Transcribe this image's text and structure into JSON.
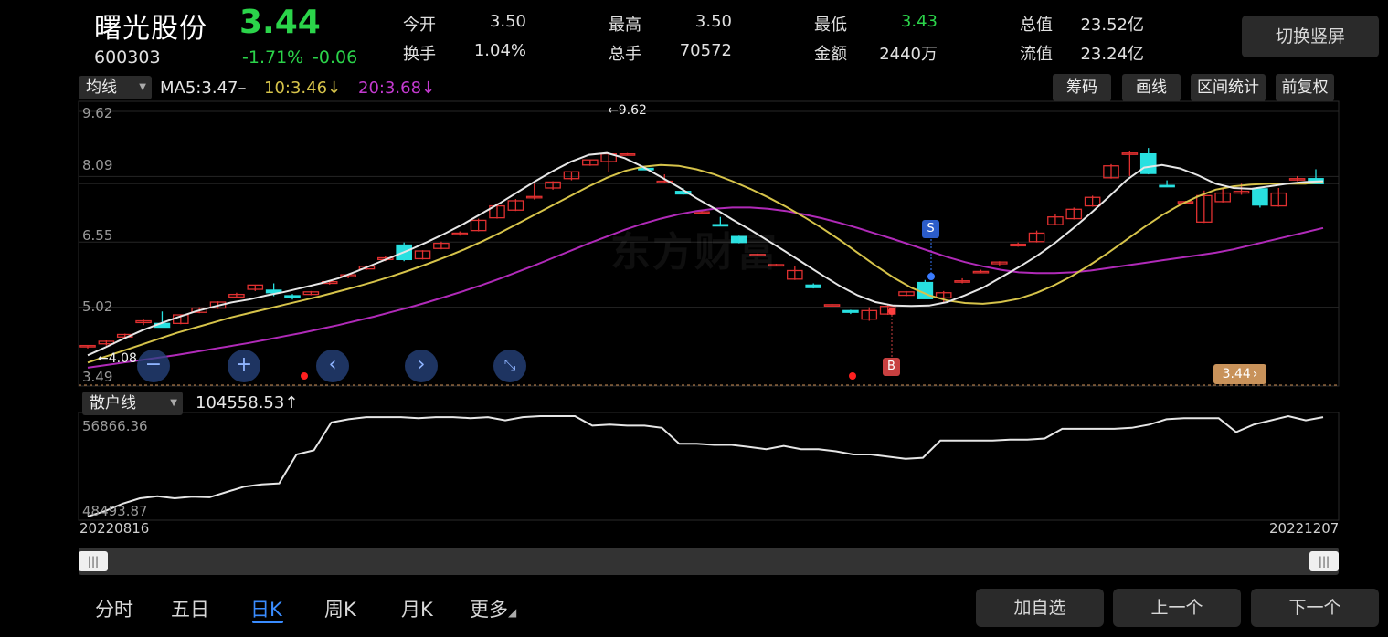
{
  "header": {
    "name": "曙光股份",
    "price": "3.44",
    "code": "600303",
    "change_pct": "-1.71%",
    "change_amt": "-0.06",
    "switch_btn": "切换竖屏"
  },
  "quote": [
    {
      "label": "今开",
      "value": "3.50",
      "color": "#e0e0e0"
    },
    {
      "label": "换手",
      "value": "1.04%",
      "color": "#e0e0e0"
    },
    {
      "label": "最高",
      "value": "3.50",
      "color": "#e0e0e0"
    },
    {
      "label": "总手",
      "value": "70572",
      "color": "#e0e0e0"
    },
    {
      "label": "最低",
      "value": "3.43",
      "color": "#2bd44a"
    },
    {
      "label": "金额",
      "value": "2440万",
      "color": "#e0e0e0"
    },
    {
      "label": "总值",
      "value": "23.52亿",
      "color": "#e0e0e0"
    },
    {
      "label": "流值",
      "value": "23.24亿",
      "color": "#e0e0e0"
    }
  ],
  "ma_bar": {
    "selector": "均线",
    "ma5": "MA5:3.47–",
    "ma10": "10:3.46↓",
    "ma20": "20:3.68↓"
  },
  "tools": {
    "chip": "筹码",
    "draw": "画线",
    "range": "区间统计",
    "adjust": "前复权"
  },
  "price_axis": [
    "9.62",
    "8.09",
    "6.55",
    "5.02",
    "3.49"
  ],
  "annotations": {
    "high": "←9.62",
    "low": "←4.08",
    "current": "3.44",
    "signal_b": "B",
    "signal_s": "S",
    "watermark": "东方财富"
  },
  "indicator": {
    "selector": "散户线",
    "value": "104558.53↑",
    "axis_top": "56866.36",
    "axis_bottom": "48493.87"
  },
  "dates": {
    "start": "20220816",
    "end": "20221207"
  },
  "periods": [
    {
      "label": "分时",
      "active": false
    },
    {
      "label": "五日",
      "active": false
    },
    {
      "label": "日K",
      "active": true
    },
    {
      "label": "周K",
      "active": false
    },
    {
      "label": "月K",
      "active": false
    },
    {
      "label": "更多",
      "active": false
    }
  ],
  "bottom_buttons": {
    "add": "加自选",
    "prev": "上一个",
    "next": "下一个"
  },
  "colors": {
    "up": "#e03030",
    "down": "#28e0e0",
    "ma5": "#e6e6e6",
    "ma10": "#d6c34a",
    "ma20": "#b02ab8",
    "price_green": "#2bd44a",
    "accent": "#3a8cff"
  },
  "icons": {
    "nav": [
      "minus-icon",
      "plus-icon",
      "chevron-left-icon",
      "chevron-right-icon",
      "collapse-icon"
    ]
  },
  "chart_data": {
    "type": "candlestick",
    "y_range": [
      3.49,
      9.62
    ],
    "up_color": "#e03030",
    "down_color": "#28e0e0",
    "candles": [
      {
        "o": 4.1,
        "h": 4.12,
        "l": 4.05,
        "c": 4.12
      },
      {
        "o": 4.16,
        "h": 4.24,
        "l": 4.12,
        "c": 4.22
      },
      {
        "o": 4.32,
        "h": 4.4,
        "l": 4.28,
        "c": 4.38
      },
      {
        "o": 4.66,
        "h": 4.73,
        "l": 4.6,
        "c": 4.7
      },
      {
        "o": 4.64,
        "h": 4.92,
        "l": 4.55,
        "c": 4.55
      },
      {
        "o": 4.64,
        "h": 4.84,
        "l": 4.62,
        "c": 4.84
      },
      {
        "o": 4.9,
        "h": 5.02,
        "l": 4.88,
        "c": 5.0
      },
      {
        "o": 5.0,
        "h": 5.16,
        "l": 4.98,
        "c": 5.14
      },
      {
        "o": 5.26,
        "h": 5.36,
        "l": 5.24,
        "c": 5.32
      },
      {
        "o": 5.44,
        "h": 5.54,
        "l": 5.4,
        "c": 5.54
      },
      {
        "o": 5.42,
        "h": 5.58,
        "l": 5.28,
        "c": 5.36
      },
      {
        "o": 5.29,
        "h": 5.33,
        "l": 5.2,
        "c": 5.26
      },
      {
        "o": 5.32,
        "h": 5.4,
        "l": 5.3,
        "c": 5.38
      },
      {
        "o": 5.58,
        "h": 5.64,
        "l": 5.55,
        "c": 5.62
      },
      {
        "o": 5.74,
        "h": 5.8,
        "l": 5.7,
        "c": 5.78
      },
      {
        "o": 5.92,
        "h": 6.0,
        "l": 5.9,
        "c": 5.98
      },
      {
        "o": 6.14,
        "h": 6.22,
        "l": 6.1,
        "c": 6.18
      },
      {
        "o": 6.48,
        "h": 6.54,
        "l": 6.1,
        "c": 6.14
      },
      {
        "o": 6.16,
        "h": 6.36,
        "l": 6.14,
        "c": 6.34
      },
      {
        "o": 6.4,
        "h": 6.56,
        "l": 6.38,
        "c": 6.52
      },
      {
        "o": 6.74,
        "h": 6.8,
        "l": 6.7,
        "c": 6.76
      },
      {
        "o": 6.82,
        "h": 7.1,
        "l": 6.8,
        "c": 7.06
      },
      {
        "o": 7.12,
        "h": 7.46,
        "l": 7.1,
        "c": 7.4
      },
      {
        "o": 7.3,
        "h": 7.56,
        "l": 7.28,
        "c": 7.52
      },
      {
        "o": 7.62,
        "h": 7.92,
        "l": 7.55,
        "c": 7.62
      },
      {
        "o": 7.82,
        "h": 7.98,
        "l": 7.78,
        "c": 7.96
      },
      {
        "o": 8.04,
        "h": 8.2,
        "l": 8.0,
        "c": 8.2
      },
      {
        "o": 8.36,
        "h": 8.48,
        "l": 8.34,
        "c": 8.48
      },
      {
        "o": 8.44,
        "h": 8.64,
        "l": 8.2,
        "c": 8.62
      },
      {
        "o": 8.62,
        "h": 8.64,
        "l": 8.6,
        "c": 8.62
      },
      {
        "o": 8.28,
        "h": 8.3,
        "l": 8.24,
        "c": 8.26
      },
      {
        "o": 7.98,
        "h": 8.14,
        "l": 7.96,
        "c": 7.98
      },
      {
        "o": 7.74,
        "h": 7.82,
        "l": 7.66,
        "c": 7.68
      },
      {
        "o": 7.26,
        "h": 7.3,
        "l": 7.24,
        "c": 7.26
      },
      {
        "o": 6.96,
        "h": 7.14,
        "l": 6.92,
        "c": 6.94
      },
      {
        "o": 6.68,
        "h": 6.7,
        "l": 6.52,
        "c": 6.54
      },
      {
        "o": 6.26,
        "h": 6.28,
        "l": 6.24,
        "c": 6.26
      },
      {
        "o": 6.02,
        "h": 6.04,
        "l": 6.0,
        "c": 6.02
      },
      {
        "o": 5.68,
        "h": 5.98,
        "l": 5.66,
        "c": 5.88
      },
      {
        "o": 5.54,
        "h": 5.58,
        "l": 5.46,
        "c": 5.48
      },
      {
        "o": 5.08,
        "h": 5.1,
        "l": 5.06,
        "c": 5.08
      },
      {
        "o": 4.94,
        "h": 4.96,
        "l": 4.86,
        "c": 4.9
      },
      {
        "o": 4.74,
        "h": 5.02,
        "l": 4.7,
        "c": 4.94
      },
      {
        "o": 4.86,
        "h": 5.1,
        "l": 4.84,
        "c": 5.04
      },
      {
        "o": 5.3,
        "h": 5.4,
        "l": 5.28,
        "c": 5.38
      },
      {
        "o": 5.6,
        "h": 5.66,
        "l": 5.22,
        "c": 5.22
      },
      {
        "o": 5.24,
        "h": 5.4,
        "l": 5.14,
        "c": 5.36
      },
      {
        "o": 5.62,
        "h": 5.7,
        "l": 5.58,
        "c": 5.64
      },
      {
        "o": 5.86,
        "h": 5.9,
        "l": 5.82,
        "c": 5.86
      },
      {
        "o": 6.04,
        "h": 6.1,
        "l": 6.0,
        "c": 6.08
      },
      {
        "o": 6.46,
        "h": 6.54,
        "l": 6.44,
        "c": 6.5
      },
      {
        "o": 6.56,
        "h": 6.82,
        "l": 6.54,
        "c": 6.76
      },
      {
        "o": 6.96,
        "h": 7.22,
        "l": 6.94,
        "c": 7.14
      },
      {
        "o": 7.1,
        "h": 7.36,
        "l": 7.08,
        "c": 7.32
      },
      {
        "o": 7.4,
        "h": 7.64,
        "l": 7.38,
        "c": 7.6
      },
      {
        "o": 8.06,
        "h": 8.38,
        "l": 8.04,
        "c": 8.34
      },
      {
        "o": 8.62,
        "h": 8.68,
        "l": 8.1,
        "c": 8.64
      },
      {
        "o": 8.62,
        "h": 8.76,
        "l": 8.14,
        "c": 8.16
      },
      {
        "o": 7.88,
        "h": 8.0,
        "l": 7.84,
        "c": 7.86
      },
      {
        "o": 7.5,
        "h": 7.52,
        "l": 7.48,
        "c": 7.5
      },
      {
        "o": 7.02,
        "h": 7.76,
        "l": 7.0,
        "c": 7.64
      },
      {
        "o": 7.5,
        "h": 7.82,
        "l": 7.48,
        "c": 7.7
      },
      {
        "o": 7.7,
        "h": 7.92,
        "l": 7.66,
        "c": 7.74
      },
      {
        "o": 7.8,
        "h": 7.84,
        "l": 7.36,
        "c": 7.42
      },
      {
        "o": 7.4,
        "h": 7.82,
        "l": 7.38,
        "c": 7.7
      },
      {
        "o": 8.04,
        "h": 8.1,
        "l": 7.98,
        "c": 8.04
      },
      {
        "o": 8.04,
        "h": 8.26,
        "l": 7.92,
        "c": 7.92
      }
    ],
    "ma5": [
      3.89,
      4.08,
      4.28,
      4.47,
      4.63,
      4.78,
      4.92,
      5.03,
      5.13,
      5.2,
      5.3,
      5.38,
      5.48,
      5.58,
      5.7,
      5.86,
      6.03,
      6.2,
      6.37,
      6.56,
      6.76,
      6.98,
      7.22,
      7.46,
      7.72,
      7.98,
      8.22,
      8.44,
      8.6,
      8.64,
      8.52,
      8.32,
      8.08,
      7.84,
      7.58,
      7.34,
      7.08,
      6.84,
      6.58,
      6.32,
      6.05,
      5.78,
      5.52,
      5.3,
      5.14,
      5.06,
      5.05,
      5.06,
      5.14,
      5.3,
      5.48,
      5.72,
      5.96,
      6.22,
      6.52,
      6.86,
      7.22,
      7.6,
      8.0,
      8.3,
      8.36,
      8.28,
      8.12,
      7.92,
      7.82,
      7.8,
      7.86,
      7.92,
      7.96,
      7.98
    ],
    "ma10": [
      3.72,
      3.86,
      4.0,
      4.14,
      4.28,
      4.42,
      4.54,
      4.66,
      4.78,
      4.88,
      4.98,
      5.08,
      5.18,
      5.28,
      5.39,
      5.5,
      5.62,
      5.75,
      5.89,
      6.04,
      6.2,
      6.37,
      6.56,
      6.76,
      6.98,
      7.2,
      7.42,
      7.64,
      7.86,
      8.06,
      8.22,
      8.32,
      8.36,
      8.34,
      8.26,
      8.14,
      7.98,
      7.8,
      7.6,
      7.38,
      7.14,
      6.88,
      6.6,
      6.3,
      6.0,
      5.72,
      5.48,
      5.3,
      5.18,
      5.12,
      5.1,
      5.14,
      5.22,
      5.36,
      5.54,
      5.76,
      6.02,
      6.3,
      6.6,
      6.9,
      7.18,
      7.42,
      7.62,
      7.78,
      7.86,
      7.9,
      7.92,
      7.92,
      7.92,
      7.96
    ],
    "ma20": [
      3.6,
      3.66,
      3.72,
      3.78,
      3.84,
      3.9,
      3.97,
      4.04,
      4.11,
      4.18,
      4.26,
      4.34,
      4.42,
      4.51,
      4.6,
      4.7,
      4.8,
      4.91,
      5.02,
      5.14,
      5.27,
      5.4,
      5.54,
      5.69,
      5.85,
      6.01,
      6.18,
      6.35,
      6.52,
      6.68,
      6.84,
      6.98,
      7.1,
      7.2,
      7.28,
      7.33,
      7.36,
      7.36,
      7.33,
      7.28,
      7.2,
      7.11,
      7.0,
      6.88,
      6.75,
      6.62,
      6.48,
      6.34,
      6.2,
      6.08,
      5.98,
      5.9,
      5.84,
      5.82,
      5.82,
      5.84,
      5.88,
      5.94,
      6.0,
      6.06,
      6.12,
      6.18,
      6.24,
      6.3,
      6.38,
      6.48,
      6.58,
      6.68,
      6.78,
      6.88
    ],
    "retail_line": {
      "y_range": [
        48493.87,
        56866.36
      ],
      "values": [
        48500,
        49000,
        49700,
        50200,
        50400,
        50200,
        50350,
        50300,
        50800,
        51300,
        51500,
        51600,
        54300,
        54700,
        57300,
        57600,
        57800,
        57800,
        57800,
        57700,
        57800,
        57800,
        57700,
        57800,
        57500,
        57800,
        58000,
        58000,
        58000,
        57000,
        57100,
        57000,
        57000,
        56800,
        55300,
        55300,
        55200,
        55200,
        55000,
        54800,
        55100,
        54800,
        54800,
        54600,
        54300,
        54300,
        54100,
        53900,
        54000,
        55600,
        55600,
        55600,
        55600,
        55700,
        55700,
        55800,
        56700,
        56700,
        56700,
        56700,
        56800,
        57100,
        57600,
        57700,
        57700,
        57700,
        56400,
        57100,
        57500,
        57900,
        57500,
        57800
      ]
    }
  }
}
